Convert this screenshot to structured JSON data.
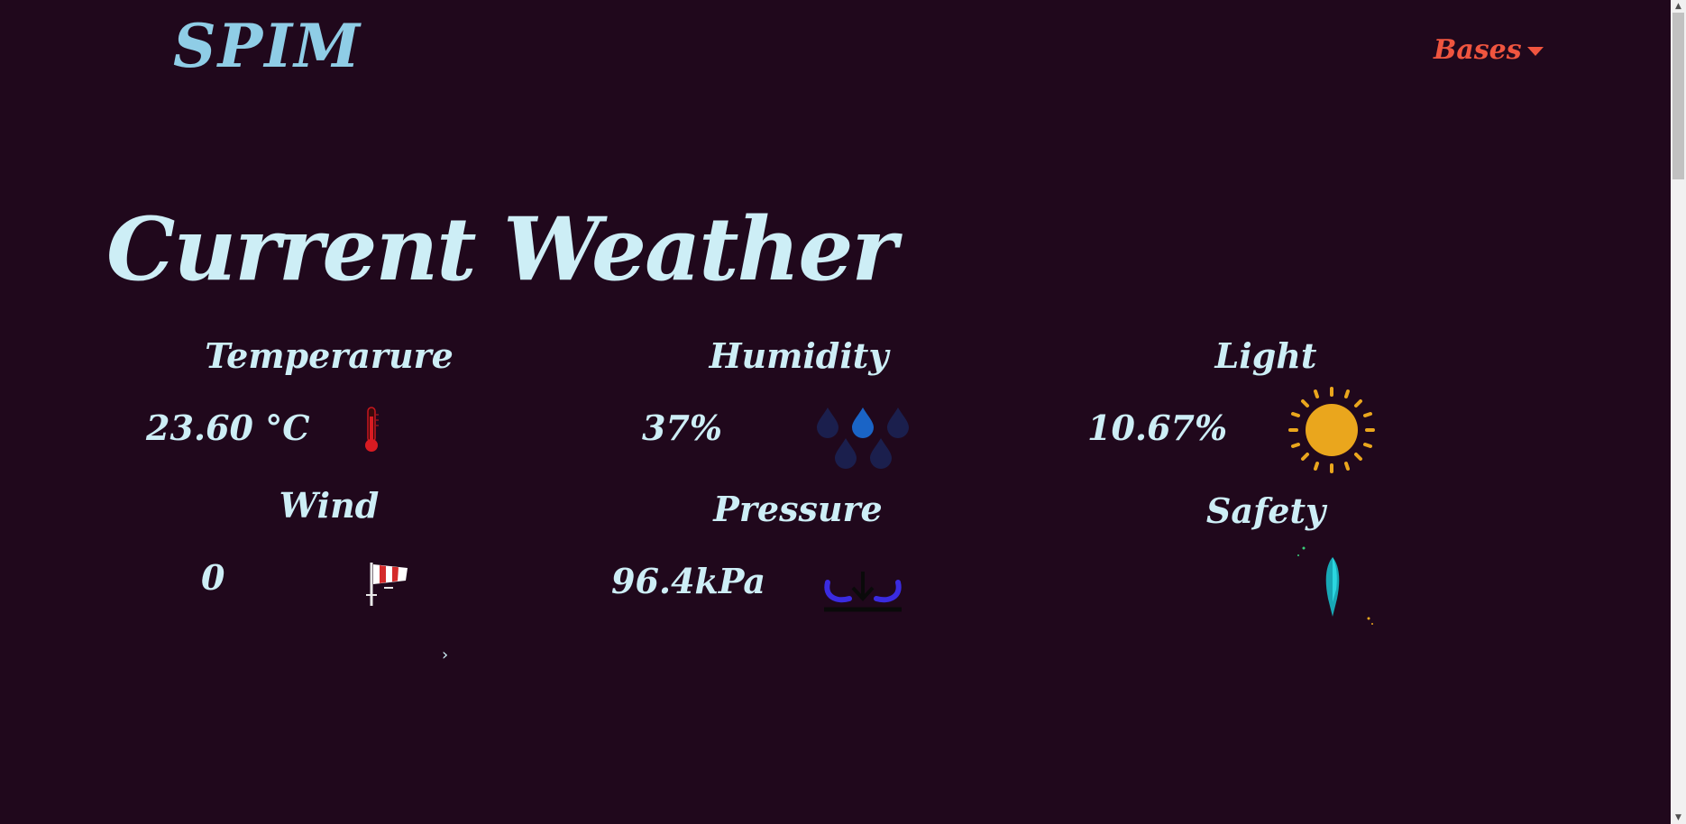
{
  "header": {
    "brand": "SPIM",
    "nav_dropdown_label": "Bases"
  },
  "main": {
    "title": "Current Weather",
    "metrics": {
      "temperature": {
        "label": "Temperarure",
        "value": "23.60 °C",
        "icon": "thermometer-icon"
      },
      "humidity": {
        "label": "Humidity",
        "value": "37%",
        "icon": "raindrops-icon"
      },
      "light": {
        "label": "Light",
        "value": "10.67%",
        "icon": "sun-icon"
      },
      "wind": {
        "label": "Wind",
        "value": "0",
        "icon": "windsock-icon"
      },
      "pressure": {
        "label": "Pressure",
        "value": "96.4kPa",
        "icon": "pressure-gauge-icon"
      },
      "safety": {
        "label": "Safety",
        "value": "",
        "icon": "rocket-icon"
      }
    },
    "stray_glyph": "›"
  },
  "colors": {
    "background": "#20081c",
    "text": "#cdeef6",
    "brand": "#8fcde6",
    "accent": "#f0553f",
    "sun": "#eaa61d"
  }
}
